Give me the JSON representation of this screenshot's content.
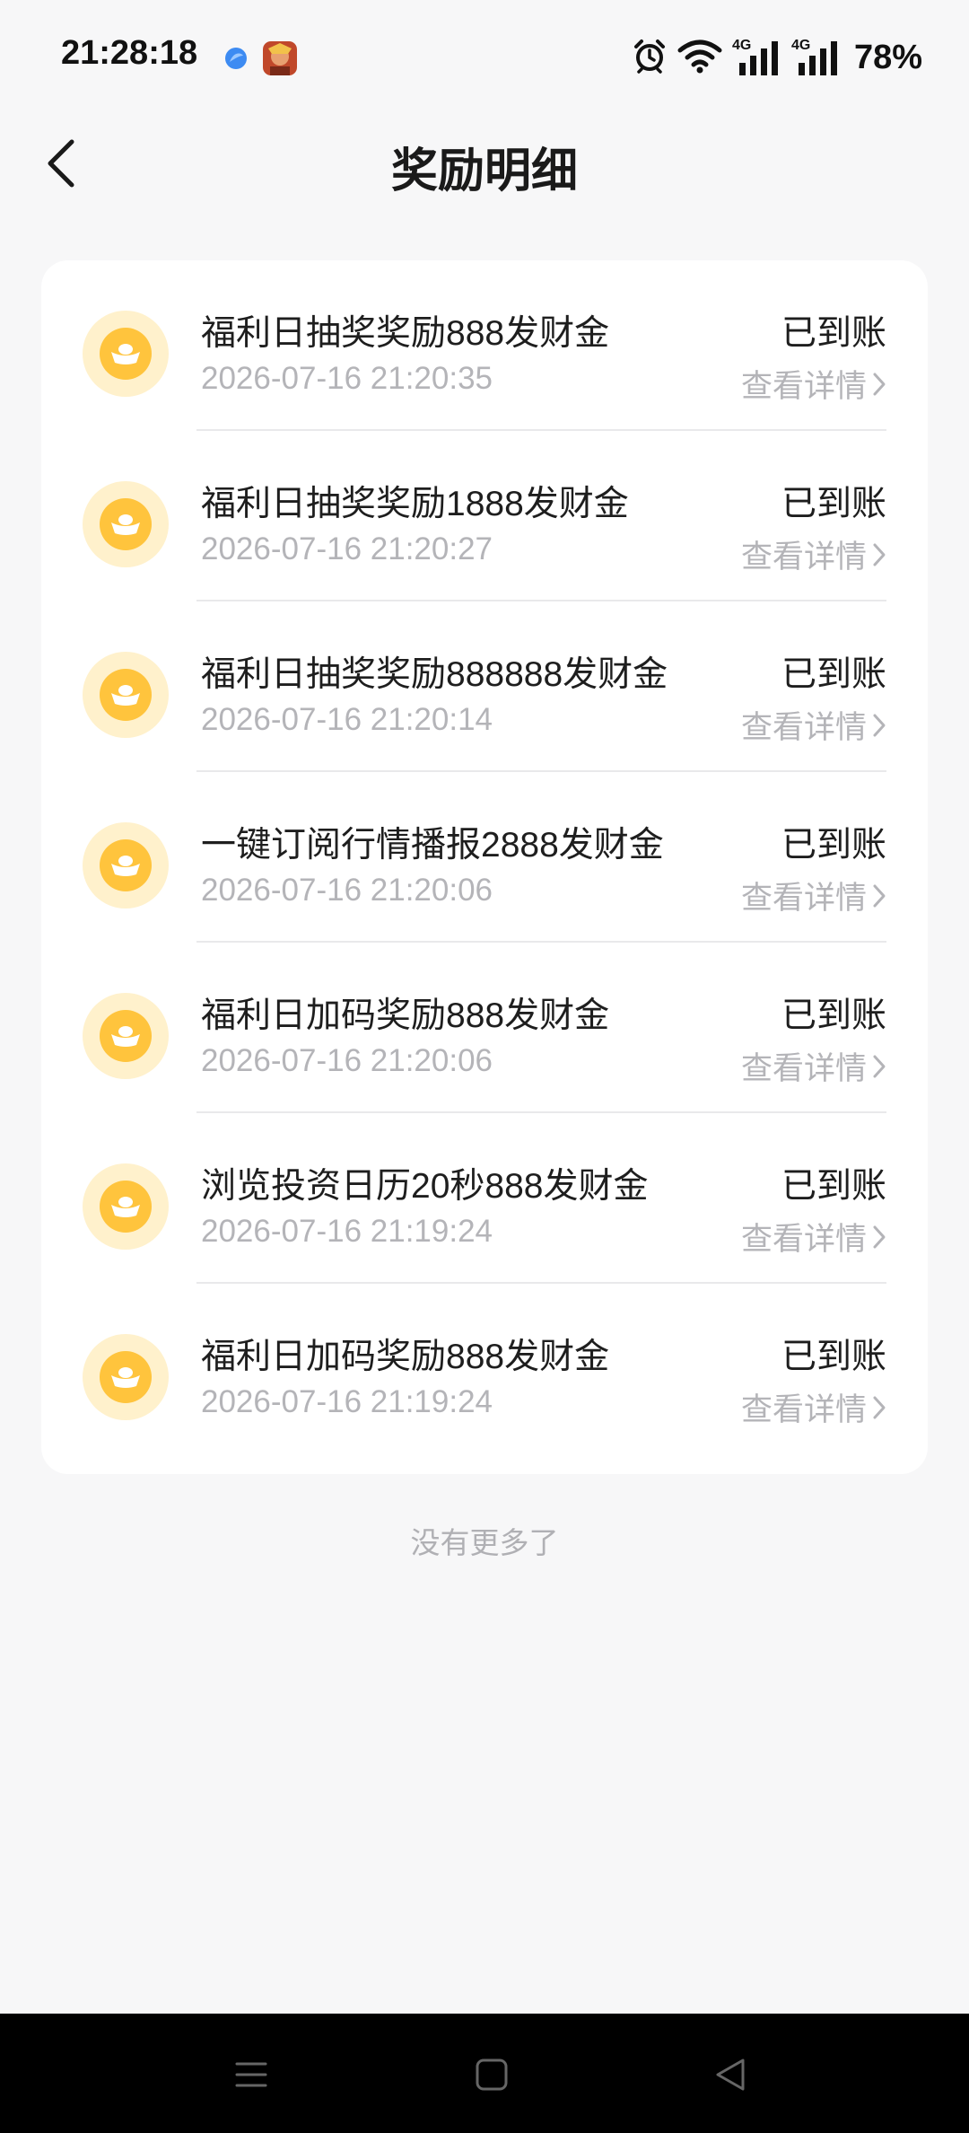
{
  "status_bar": {
    "time": "21:28:18",
    "battery": "78%",
    "network1": "4G",
    "network2": "4G"
  },
  "header": {
    "title": "奖励明细"
  },
  "items": [
    {
      "title": "福利日抽奖奖励888发财金",
      "time": "2026-07-16 21:20:35",
      "status": "已到账",
      "detail": "查看详情"
    },
    {
      "title": "福利日抽奖奖励1888发财金",
      "time": "2026-07-16 21:20:27",
      "status": "已到账",
      "detail": "查看详情"
    },
    {
      "title": "福利日抽奖奖励888888发财金",
      "time": "2026-07-16 21:20:14",
      "status": "已到账",
      "detail": "查看详情"
    },
    {
      "title": "一键订阅行情播报2888发财金",
      "time": "2026-07-16 21:20:06",
      "status": "已到账",
      "detail": "查看详情"
    },
    {
      "title": "福利日加码奖励888发财金",
      "time": "2026-07-16 21:20:06",
      "status": "已到账",
      "detail": "查看详情"
    },
    {
      "title": "浏览投资日历20秒888发财金",
      "time": "2026-07-16 21:19:24",
      "status": "已到账",
      "detail": "查看详情"
    },
    {
      "title": "福利日加码奖励888发财金",
      "time": "2026-07-16 21:19:24",
      "status": "已到账",
      "detail": "查看详情"
    }
  ],
  "footer": {
    "no_more": "没有更多了"
  },
  "colors": {
    "background": "#F7F7F8",
    "card": "#FFFFFF",
    "coin_outer": "#FFF1CC",
    "coin_inner": "#FFC43D",
    "text_primary": "#1E1E1E",
    "text_secondary": "#B4B4B8"
  }
}
